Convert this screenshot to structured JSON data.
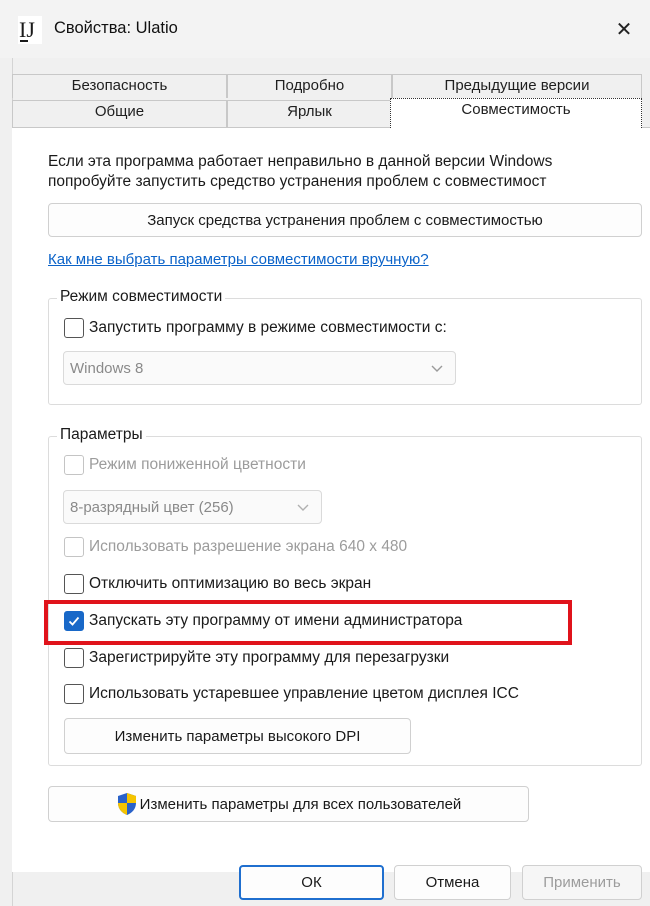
{
  "window": {
    "title": "Свойства: Ulatio",
    "close_glyph": "✕"
  },
  "tabs": {
    "row_top": [
      {
        "label": "Безопасность"
      },
      {
        "label": "Подробно"
      },
      {
        "label": "Предыдущие версии"
      }
    ],
    "row_bottom": [
      {
        "label": "Общие"
      },
      {
        "label": "Ярлык"
      },
      {
        "label": "Совместимость",
        "active": true
      }
    ]
  },
  "compat": {
    "intro_line1": "Если эта программа работает неправильно в данной версии Windows",
    "intro_line2": "попробуйте запустить средство устранения проблем с совместимост",
    "troubleshoot_button": "Запуск средства устранения проблем с совместимостью",
    "manual_link": "Как мне выбрать параметры совместимости вручную?"
  },
  "compat_mode": {
    "group_label": "Режим совместимости",
    "checkbox_label": "Запустить программу в режиме совместимости с:",
    "checked": false,
    "os_selected": "Windows 8"
  },
  "settings": {
    "group_label": "Параметры",
    "reduced_color_label": "Режим пониженной цветности",
    "color_selected": "8-разрядный цвет (256)",
    "resolution_label": "Использовать разрешение экрана 640 x 480",
    "fullscreen_label": "Отключить оптимизацию во весь экран",
    "run_as_admin_label": "Запускать эту программу от имени администратора",
    "run_as_admin_checked": true,
    "register_restart_label": "Зарегистрируйте эту программу для перезагрузки",
    "legacy_icc_label": "Использовать устаревшее управление цветом дисплея ICC",
    "dpi_button": "Изменить параметры высокого DPI"
  },
  "all_users_button": "Изменить параметры для всех пользователей",
  "footer": {
    "ok": "ОК",
    "cancel": "Отмена",
    "apply": "Применить"
  },
  "colors": {
    "highlight": "#e0131b",
    "accent": "#1868c8",
    "link": "#0b63c9"
  }
}
